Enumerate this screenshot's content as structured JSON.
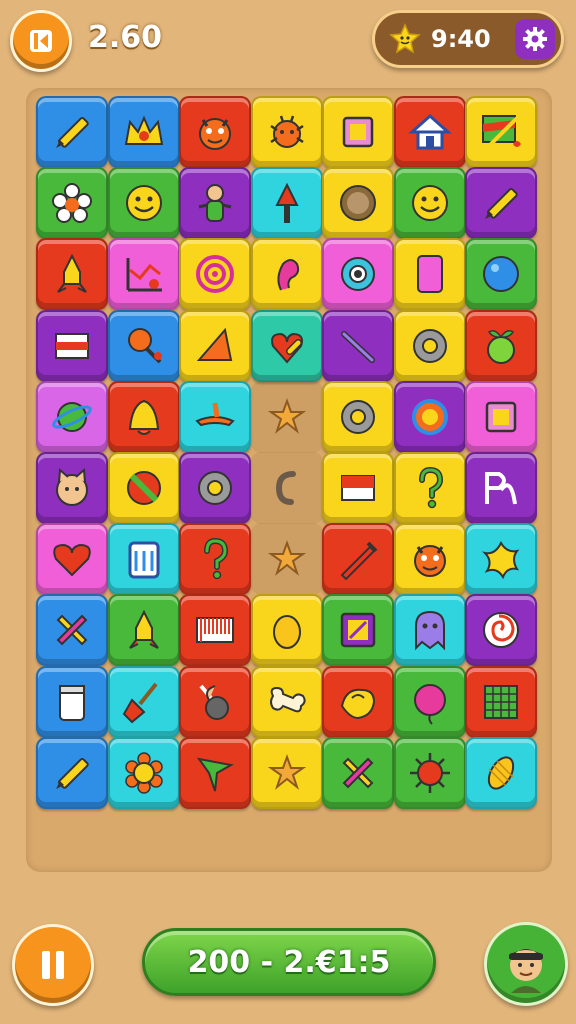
{
  "header": {
    "score": "2.60",
    "timer": "9:40",
    "back_icon": "back-arrow-icon",
    "timer_icon": "star-buddy-icon",
    "settings_icon": "gear-icon"
  },
  "footer": {
    "status": "200 - 2.€1:5",
    "pause_icon": "pause-icon",
    "avatar_icon": "player-avatar-icon"
  },
  "colors": {
    "blue": "#2f8fe6",
    "red": "#e63a1e",
    "orange": "#f36d1c",
    "yellow": "#f9d51c",
    "green": "#48b93a",
    "purple": "#8e2fbf",
    "cyan": "#2fd4de",
    "pink": "#f05fd8",
    "teal": "#2ec9a6",
    "magenta": "#d966e6",
    "board": "#d9a86b"
  },
  "board": {
    "rows": [
      [
        {
          "color": "blue",
          "icon": "pencil-icon"
        },
        {
          "color": "blue",
          "icon": "crown-badge-icon"
        },
        {
          "color": "red",
          "icon": "monster-icon"
        },
        {
          "color": "yellow",
          "icon": "bug-icon"
        },
        {
          "color": "yellow",
          "icon": "square-icon"
        },
        {
          "color": "red",
          "icon": "house-icon"
        },
        {
          "color": "yellow",
          "icon": "painting-icon"
        }
      ],
      [
        {
          "color": "green",
          "icon": "flower-icon"
        },
        {
          "color": "green",
          "icon": "smiley-icon"
        },
        {
          "color": "purple",
          "icon": "doll-icon"
        },
        {
          "color": "cyan",
          "icon": "arrow-up-icon"
        },
        {
          "color": "yellow",
          "icon": "cookie-icon"
        },
        {
          "color": "green",
          "icon": "smiley-icon"
        },
        {
          "color": "purple",
          "icon": "pencil-icon"
        }
      ],
      [
        {
          "color": "red",
          "icon": "rocket-icon"
        },
        {
          "color": "pink",
          "icon": "chart-icon"
        },
        {
          "color": "yellow",
          "icon": "target-icon"
        },
        {
          "color": "yellow",
          "icon": "ear-icon"
        },
        {
          "color": "pink",
          "icon": "eye-icon"
        },
        {
          "color": "yellow",
          "icon": "phone-icon"
        },
        {
          "color": "green",
          "icon": "ball-icon"
        }
      ],
      [
        {
          "color": "purple",
          "icon": "flag-stripe-icon"
        },
        {
          "color": "blue",
          "icon": "lollipop-icon"
        },
        {
          "color": "yellow",
          "icon": "cone-icon"
        },
        {
          "color": "teal",
          "icon": "heart-key-icon"
        },
        {
          "color": "purple",
          "icon": "stick-icon"
        },
        {
          "color": "yellow",
          "icon": "ring-icon"
        },
        {
          "color": "red",
          "icon": "fruit-icon"
        }
      ],
      [
        {
          "color": "magenta",
          "icon": "planet-icon"
        },
        {
          "color": "red",
          "icon": "bell-icon"
        },
        {
          "color": "cyan",
          "icon": "lamp-icon"
        },
        {
          "color": "empty",
          "icon": "star-icon"
        },
        {
          "color": "yellow",
          "icon": "ring-icon"
        },
        {
          "color": "purple",
          "icon": "circle-icon"
        },
        {
          "color": "pink",
          "icon": "square-icon"
        }
      ],
      [
        {
          "color": "purple",
          "icon": "cat-icon"
        },
        {
          "color": "yellow",
          "icon": "no-sign-icon"
        },
        {
          "color": "purple",
          "icon": "ring-icon"
        },
        {
          "color": "empty",
          "icon": "hook-icon"
        },
        {
          "color": "yellow",
          "icon": "flag-icon"
        },
        {
          "color": "yellow",
          "icon": "question-icon"
        },
        {
          "color": "purple",
          "icon": "letter-icon"
        }
      ],
      [
        {
          "color": "pink",
          "icon": "heart-icon"
        },
        {
          "color": "cyan",
          "icon": "jar-icon"
        },
        {
          "color": "red",
          "icon": "question-icon"
        },
        {
          "color": "empty",
          "icon": "star-icon"
        },
        {
          "color": "red",
          "icon": "pen-icon"
        },
        {
          "color": "yellow",
          "icon": "monster-icon"
        },
        {
          "color": "cyan",
          "icon": "splat-icon"
        }
      ],
      [
        {
          "color": "blue",
          "icon": "cross-icon"
        },
        {
          "color": "green",
          "icon": "rocket-icon"
        },
        {
          "color": "red",
          "icon": "barcode-icon"
        },
        {
          "color": "yellow",
          "icon": "egg-icon"
        },
        {
          "color": "green",
          "icon": "frame-icon"
        },
        {
          "color": "cyan",
          "icon": "ghost-icon"
        },
        {
          "color": "purple",
          "icon": "spiral-icon"
        }
      ],
      [
        {
          "color": "blue",
          "icon": "cup-icon"
        },
        {
          "color": "cyan",
          "icon": "broom-icon"
        },
        {
          "color": "red",
          "icon": "bomb-icon"
        },
        {
          "color": "yellow",
          "icon": "bone-icon"
        },
        {
          "color": "red",
          "icon": "bird-icon"
        },
        {
          "color": "green",
          "icon": "balloon-icon"
        },
        {
          "color": "red",
          "icon": "grid-icon"
        }
      ],
      [
        {
          "color": "blue",
          "icon": "pencil-icon"
        },
        {
          "color": "cyan",
          "icon": "sunflower-icon"
        },
        {
          "color": "red",
          "icon": "tree-icon"
        },
        {
          "color": "yellow",
          "icon": "star-icon"
        },
        {
          "color": "green",
          "icon": "cross-icon"
        },
        {
          "color": "green",
          "icon": "virus-icon"
        },
        {
          "color": "cyan",
          "icon": "corn-icon"
        }
      ]
    ]
  }
}
